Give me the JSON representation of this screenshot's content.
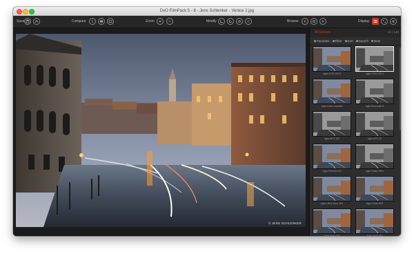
{
  "window": {
    "title": "DxO FilmPack 5 - 8 - Jens Schlenker - Venice 2.jpg"
  },
  "toolbar": {
    "save_label": "Save",
    "compare_label": "Compare",
    "zoom_label": "Zoom",
    "modify_label": "Modify",
    "browse_label": "Browse",
    "display_label": "Display"
  },
  "photo": {
    "copyright": "© JENS SCHLENKER"
  },
  "sidebar": {
    "title": "All presets",
    "count": "12 / 120",
    "filters": [
      "Favorites",
      "Filter",
      "Sort",
      "Search",
      "New"
    ],
    "presets": [
      {
        "label": "Agfa CHS 100 II",
        "tone": "color"
      },
      {
        "label": "Agfa CHS 100 II",
        "tone": "bw"
      },
      {
        "label": "Agfa Color Invisible",
        "tone": "color"
      },
      {
        "label": "Agfa Silversalt III",
        "tone": "bw"
      },
      {
        "label": "Agfa APX 100",
        "tone": "bw"
      },
      {
        "label": "Agfa APX 25",
        "tone": "bw"
      },
      {
        "label": "Agfa Precisa 100",
        "tone": "color"
      },
      {
        "label": "Agfa Scala 200x",
        "tone": "bw"
      },
      {
        "label": "Agfa Ultra Color 100",
        "tone": "color"
      },
      {
        "label": "Agfa Scala 500",
        "tone": "color"
      },
      {
        "label": "Agfa Vista 200",
        "tone": "color"
      },
      {
        "label": "Agfa Vista 400",
        "tone": "color"
      }
    ],
    "selected_index": 1
  },
  "colors": {
    "accent": "#d9301f",
    "panel": "#2e2e2e",
    "toolbar": "#262626"
  }
}
